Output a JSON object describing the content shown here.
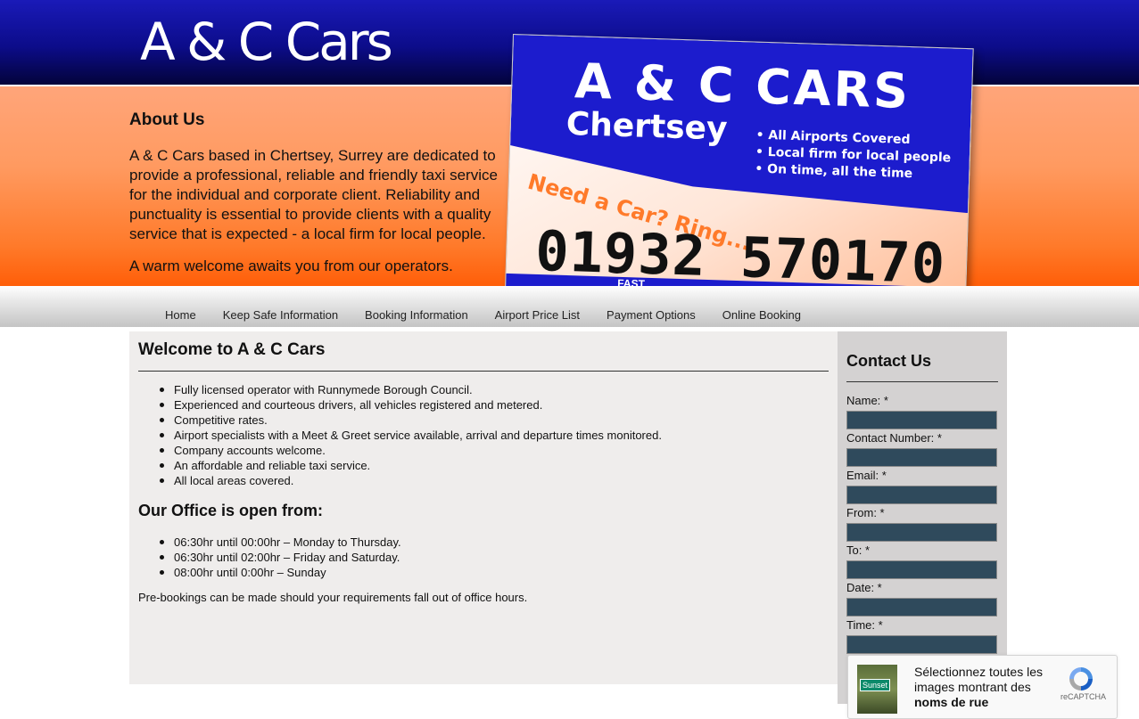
{
  "header": {
    "logo_text": "A & C Cars",
    "about": {
      "heading": "About Us",
      "paragraph1": "A & C Cars based in Chertsey, Surrey are dedicated to provide a professional, reliable and friendly taxi service for the individual and corporate client. Reliability and punctuality is essential to provide clients with a quality service that is expected - a local firm for local people.",
      "paragraph2": "A warm welcome awaits you from our operators."
    },
    "sign": {
      "title": "A & C CARS",
      "subtitle": "Chertsey",
      "bullets": [
        "• All Airports Covered",
        "• Local firm for local people",
        "• On time, all the time"
      ],
      "tagline": "Need a Car? Ring...",
      "phone": "01932 570170",
      "bottom": "FAST"
    }
  },
  "nav": {
    "items": [
      "Home",
      "Keep Safe Information",
      "Booking Information",
      "Airport Price List",
      "Payment Options",
      "Online Booking"
    ]
  },
  "main": {
    "title": "Welcome to A & C Cars",
    "features": [
      "Fully licensed operator with Runnymede Borough Council.",
      "Experienced and courteous drivers, all vehicles registered and metered.",
      "Competitive rates.",
      "Airport specialists with a Meet & Greet service available, arrival and departure times monitored.",
      "Company accounts welcome.",
      "An affordable and reliable taxi service.",
      "All local areas covered."
    ],
    "hours_heading": "Our Office is open from:",
    "hours": [
      "06:30hr until 00:00hr – Monday to Thursday.",
      "06:30hr until 02:00hr – Friday and Saturday.",
      "08:00hr until 0:00hr – Sunday"
    ],
    "prebook_note": "Pre-bookings can be made should your requirements fall out of office hours."
  },
  "contact": {
    "heading": "Contact Us",
    "fields": [
      {
        "label": "Name: *",
        "value": ""
      },
      {
        "label": "Contact Number: *",
        "value": ""
      },
      {
        "label": "Email: *",
        "value": ""
      },
      {
        "label": "From: *",
        "value": ""
      },
      {
        "label": "To: *",
        "value": ""
      },
      {
        "label": "Date: *",
        "value": ""
      },
      {
        "label": "Time: *",
        "value": ""
      }
    ]
  },
  "recaptcha": {
    "line1": "Sélectionnez toutes les images montrant des",
    "line2": "noms de rue",
    "thumb_sign": "Sunset",
    "label": "reCAPTCHA"
  },
  "colors": {
    "header_blue": "#0c0c8a",
    "header_orange": "#ff7a2a",
    "input_fill": "#2f4a5c",
    "panel_bg": "#efedec",
    "sidebar_bg": "#d4d2d2"
  }
}
